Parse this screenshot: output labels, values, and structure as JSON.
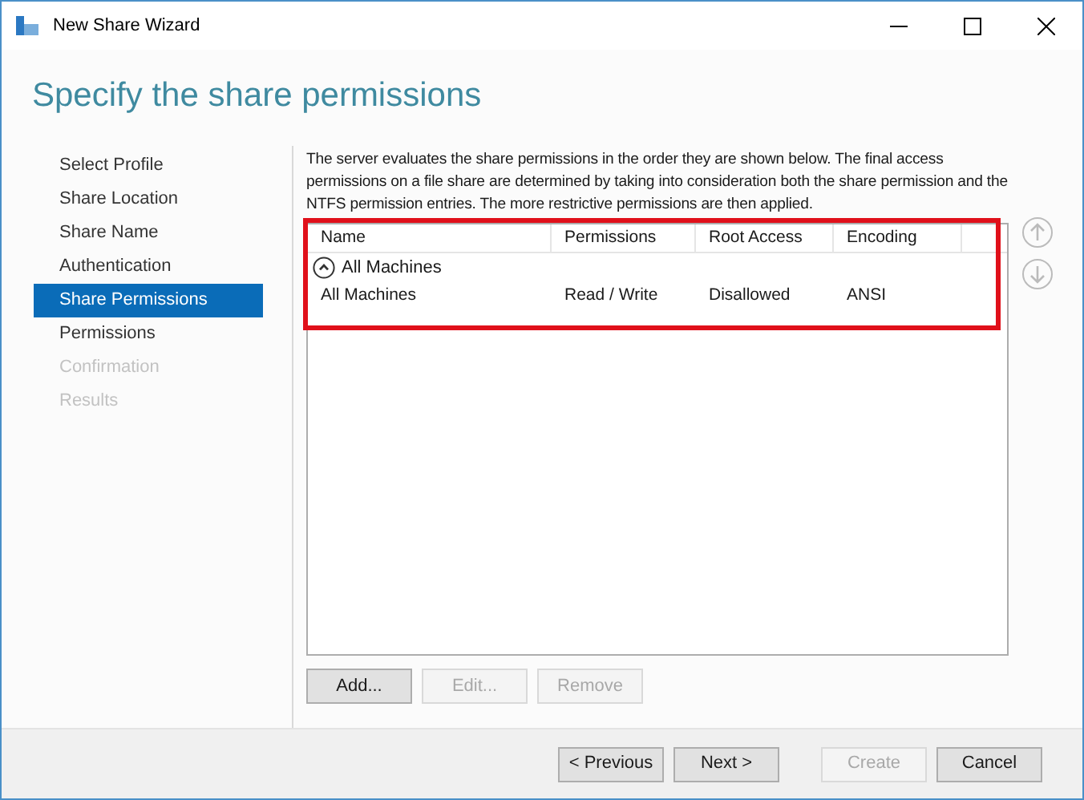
{
  "window": {
    "title": "New Share Wizard"
  },
  "page_title": "Specify the share permissions",
  "steps": [
    {
      "label": "Select Profile",
      "selected": false,
      "disabled": false
    },
    {
      "label": "Share Location",
      "selected": false,
      "disabled": false
    },
    {
      "label": "Share Name",
      "selected": false,
      "disabled": false
    },
    {
      "label": "Authentication",
      "selected": false,
      "disabled": false
    },
    {
      "label": "Share Permissions",
      "selected": true,
      "disabled": false
    },
    {
      "label": "Permissions",
      "selected": false,
      "disabled": false
    },
    {
      "label": "Confirmation",
      "selected": false,
      "disabled": true
    },
    {
      "label": "Results",
      "selected": false,
      "disabled": true
    }
  ],
  "description": "The server evaluates the share permissions in the order they are shown below. The final access permissions on a file share are determined by taking into consideration both the share permission and the NTFS permission entries. The more restrictive permissions are then applied.",
  "table": {
    "columns": [
      "Name",
      "Permissions",
      "Root Access",
      "Encoding"
    ],
    "groups": [
      {
        "name": "All Machines",
        "expanded": true,
        "rows": [
          {
            "cells": [
              "All Machines",
              "Read / Write",
              "Disallowed",
              "ANSI"
            ]
          }
        ]
      }
    ]
  },
  "table_buttons": [
    {
      "label": "Add...",
      "disabled": false
    },
    {
      "label": "Edit...",
      "disabled": true
    },
    {
      "label": "Remove",
      "disabled": true
    }
  ],
  "footer_buttons": [
    {
      "label": "< Previous",
      "disabled": false
    },
    {
      "label": "Next >",
      "disabled": false
    },
    {
      "label": "Create",
      "disabled": true
    },
    {
      "label": "Cancel",
      "disabled": false
    }
  ]
}
